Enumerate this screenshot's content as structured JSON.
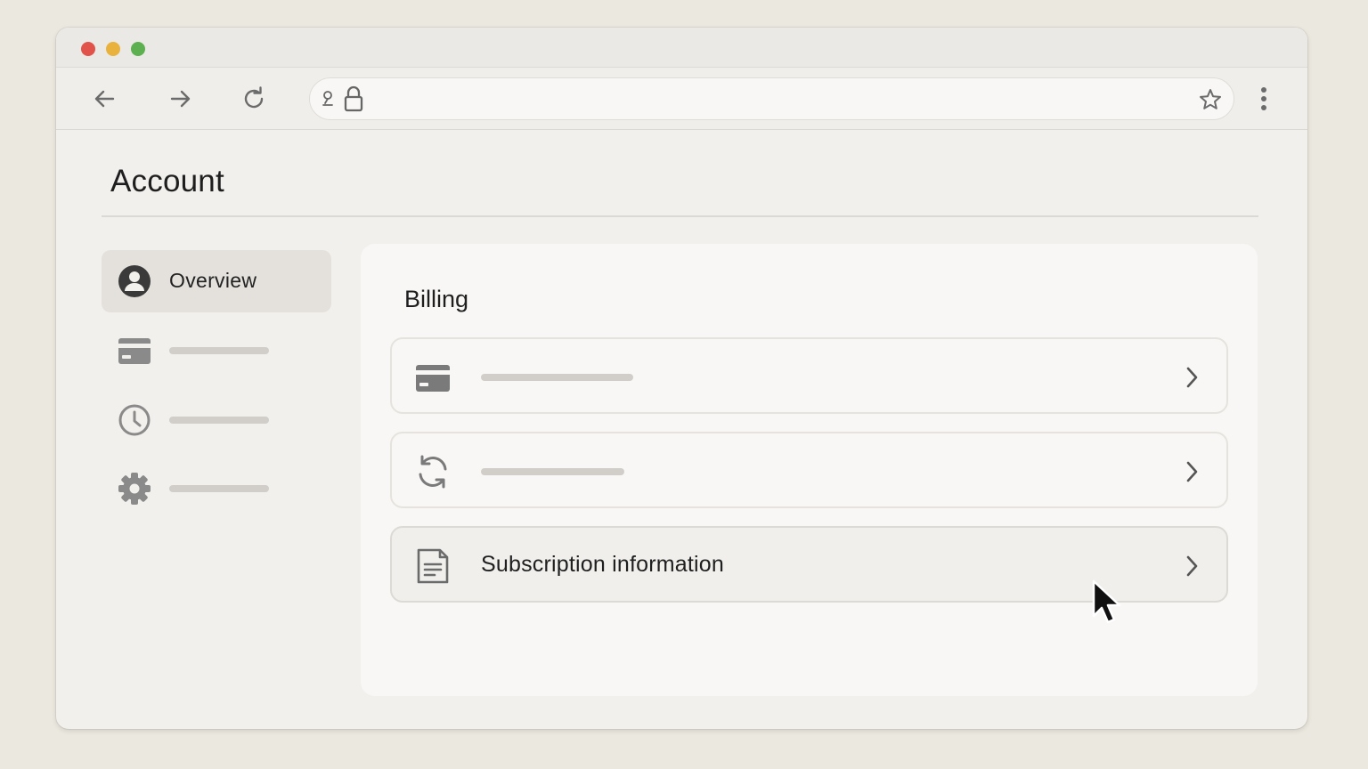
{
  "window": {
    "traffic_lights": [
      "close",
      "minimize",
      "maximize"
    ]
  },
  "toolbar": {
    "back_icon": "arrow-left-icon",
    "forward_icon": "arrow-right-icon",
    "reload_icon": "reload-icon",
    "address": {
      "url": "",
      "site_settings_icon": "tune-icon",
      "lock_icon": "lock-icon",
      "bookmark_icon": "star-icon"
    },
    "menu_icon": "kebab-menu-icon"
  },
  "page": {
    "title": "Account"
  },
  "sidebar": {
    "items": [
      {
        "label": "Overview",
        "icon": "user-circle-icon",
        "active": true
      },
      {
        "label": "",
        "icon": "credit-card-icon",
        "active": false
      },
      {
        "label": "",
        "icon": "clock-icon",
        "active": false
      },
      {
        "label": "",
        "icon": "gear-icon",
        "active": false
      }
    ]
  },
  "billing": {
    "title": "Billing",
    "rows": [
      {
        "label": "",
        "icon": "credit-card-icon"
      },
      {
        "label": "",
        "icon": "refresh-cycle-icon"
      },
      {
        "label": "Subscription information",
        "icon": "document-icon",
        "hovered": true
      }
    ]
  },
  "colors": {
    "background": "#ebe8df",
    "window": "#f2f0ec",
    "panel": "#f8f7f5",
    "text": "#1e1e1e",
    "icon": "#6b6b6b",
    "placeholder": "#d1cec9",
    "close": "#e0524a",
    "minimize": "#e8b23d",
    "maximize": "#5db04f"
  }
}
